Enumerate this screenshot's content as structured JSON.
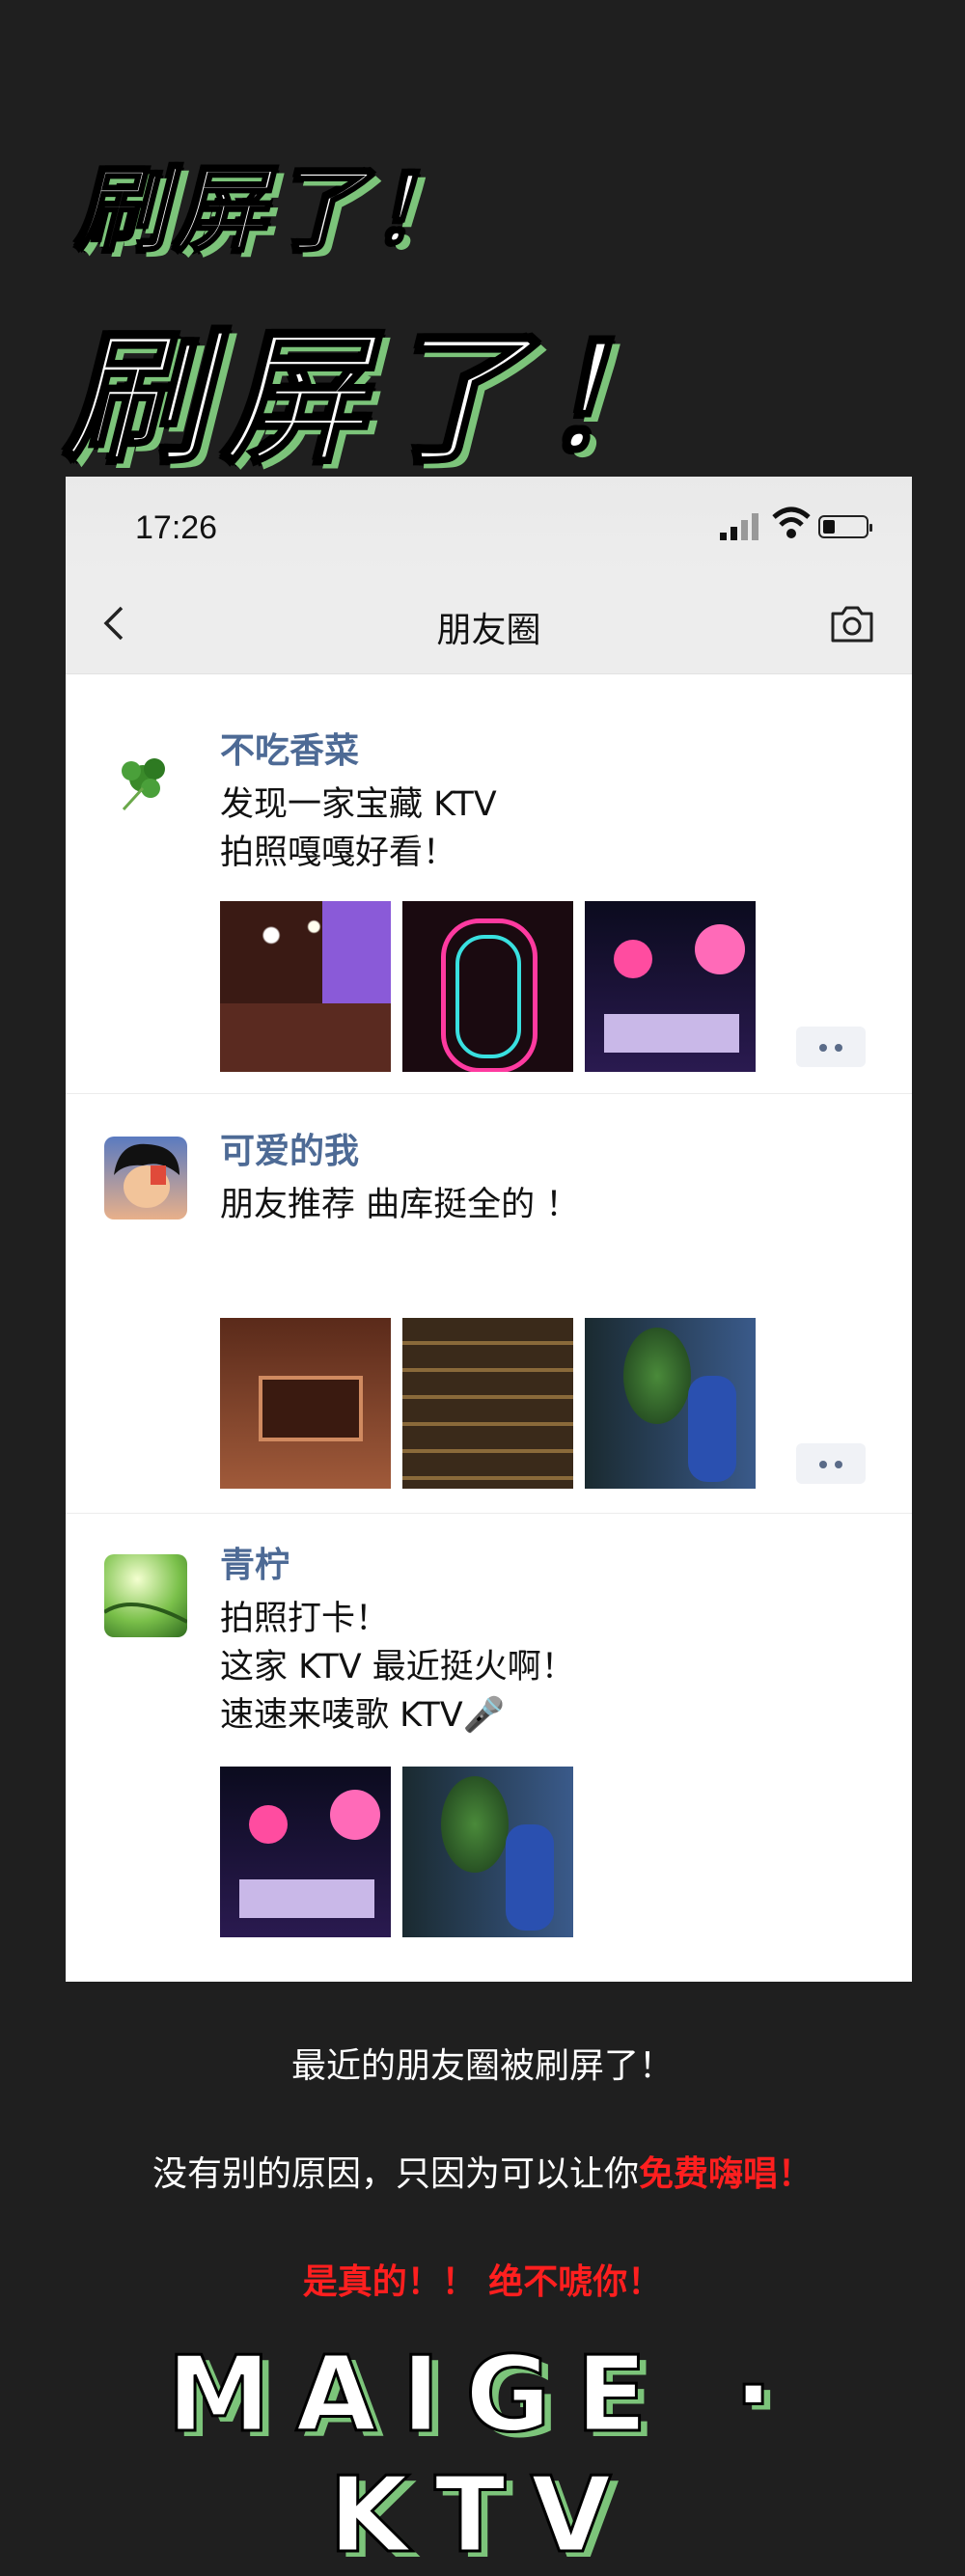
{
  "headline": {
    "line1": "刷屏了！",
    "line2": "刷屏了！"
  },
  "status": {
    "time": "17:26"
  },
  "nav": {
    "title": "朋友圈"
  },
  "posts": [
    {
      "name": "不吃香菜",
      "text": "发现一家宝藏 KTV\n拍照嘎嘎好看！"
    },
    {
      "name": "可爱的我",
      "text": "朋友推荐 曲库挺全的 ！"
    },
    {
      "name": "青柠",
      "text": "拍照打卡！\n这家 KTV 最近挺火啊！\n速速来唛歌 KTV🎤"
    }
  ],
  "footer": {
    "line1": "最近的朋友圈被刷屏了！",
    "line2_prefix": "没有别的原因，只因为可以让你",
    "line2_highlight": "免费嗨唱！",
    "line3": "是真的！！ 绝不唬你！",
    "brand": "MAIGE · KTV"
  },
  "colors": {
    "accent_green": "#7cc47a",
    "highlight_red": "#ff1f1f",
    "name_blue": "#4d6a95"
  }
}
